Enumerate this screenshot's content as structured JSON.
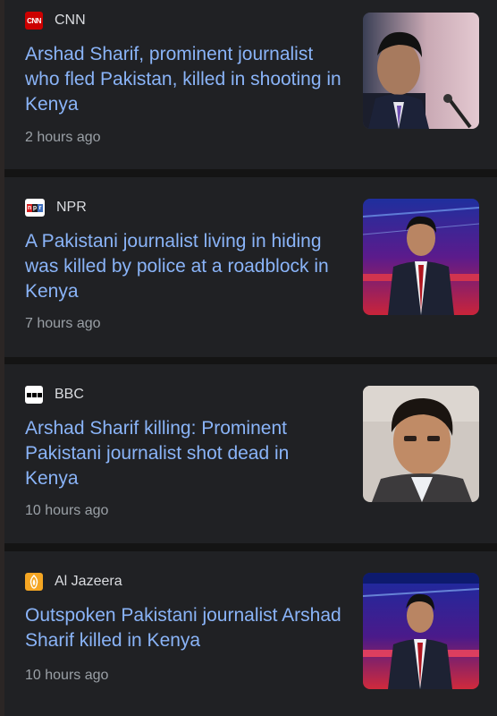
{
  "articles": [
    {
      "source": "CNN",
      "logo_icon": "cnn-logo-icon",
      "headline": "Arshad Sharif, prominent journalist who fled Pakistan, killed in shooting in Kenya",
      "time": "2 hours ago"
    },
    {
      "source": "NPR",
      "logo_icon": "npr-logo-icon",
      "headline": "A Pakistani journalist living in hiding was killed by police at a roadblock in Kenya",
      "time": "7 hours ago"
    },
    {
      "source": "BBC",
      "logo_icon": "bbc-logo-icon",
      "headline": "Arshad Sharif killing: Prominent Pakistani journalist shot dead in Kenya",
      "time": "10 hours ago"
    },
    {
      "source": "Al Jazeera",
      "logo_icon": "al-jazeera-logo-icon",
      "headline": "Outspoken Pakistani journalist Arshad Sharif killed in Kenya",
      "time": "10 hours ago"
    }
  ],
  "logos": {
    "cnn": "CNN",
    "npr": [
      "n",
      "p",
      "r"
    ]
  },
  "colors": {
    "background": "#141414",
    "card": "#202124",
    "headline": "#8ab4f8",
    "source": "#dadce0",
    "time": "#9aa0a6",
    "cnn_red": "#cc0000",
    "al_jazeera_orange": "#f5a623"
  }
}
